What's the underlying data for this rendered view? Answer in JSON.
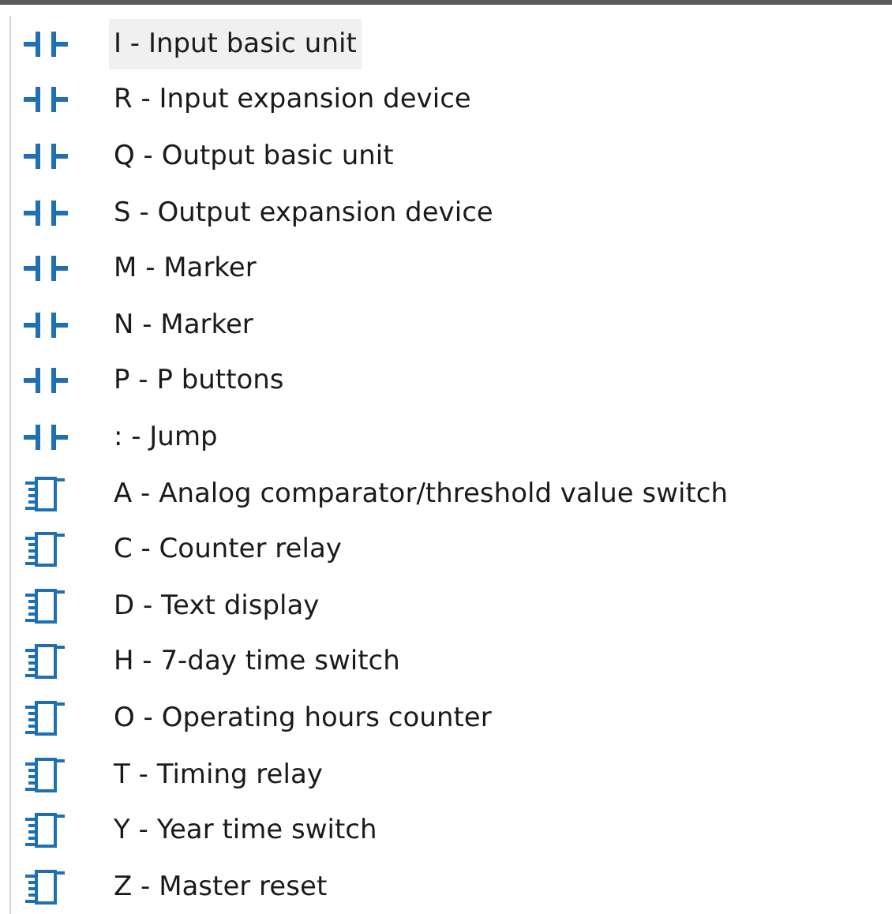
{
  "items": [
    {
      "kind": "contact",
      "label": "I - Input basic unit",
      "selected": true
    },
    {
      "kind": "contact",
      "label": "R - Input expansion device",
      "selected": false
    },
    {
      "kind": "contact",
      "label": "Q - Output basic unit",
      "selected": false
    },
    {
      "kind": "contact",
      "label": "S - Output expansion device",
      "selected": false
    },
    {
      "kind": "contact",
      "label": "M - Marker",
      "selected": false
    },
    {
      "kind": "contact",
      "label": "N - Marker",
      "selected": false
    },
    {
      "kind": "contact",
      "label": "P - P buttons",
      "selected": false
    },
    {
      "kind": "contact",
      "label": ": - Jump",
      "selected": false
    },
    {
      "kind": "block",
      "label": "A - Analog comparator/threshold value switch",
      "selected": false
    },
    {
      "kind": "block",
      "label": "C - Counter relay",
      "selected": false
    },
    {
      "kind": "block",
      "label": "D - Text display",
      "selected": false
    },
    {
      "kind": "block",
      "label": "H - 7-day time switch",
      "selected": false
    },
    {
      "kind": "block",
      "label": "O - Operating hours counter",
      "selected": false
    },
    {
      "kind": "block",
      "label": "T - Timing relay",
      "selected": false
    },
    {
      "kind": "block",
      "label": "Y - Year time switch",
      "selected": false
    },
    {
      "kind": "block",
      "label": "Z - Master reset",
      "selected": false
    }
  ]
}
